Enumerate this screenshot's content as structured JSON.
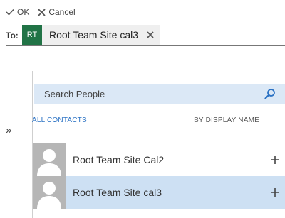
{
  "toolbar": {
    "ok_label": "OK",
    "cancel_label": "Cancel"
  },
  "recipients": {
    "to_label": "To:",
    "chips": [
      {
        "initials": "RT",
        "label": "Root Team Site cal3",
        "avatar_color": "#217346"
      }
    ]
  },
  "expand_icon": "»",
  "people_picker": {
    "search_placeholder": "Search People",
    "filter_label": "ALL CONTACTS",
    "sort_label": "BY DISPLAY NAME",
    "results": [
      {
        "name": "Root Team Site Cal2",
        "selected": false
      },
      {
        "name": "Root Team Site cal3",
        "selected": true
      }
    ]
  },
  "colors": {
    "accent": "#2b72c4",
    "chip_avatar": "#217346",
    "search_bg": "#dbe8f6",
    "selected_row_bg": "#cde0f3"
  },
  "icons": {
    "ok": "checkmark-icon",
    "cancel": "close-icon",
    "chip_remove": "close-icon",
    "expand": "double-chevron-right-icon",
    "search": "search-icon",
    "add": "plus-icon",
    "avatar": "person-silhouette-icon"
  }
}
